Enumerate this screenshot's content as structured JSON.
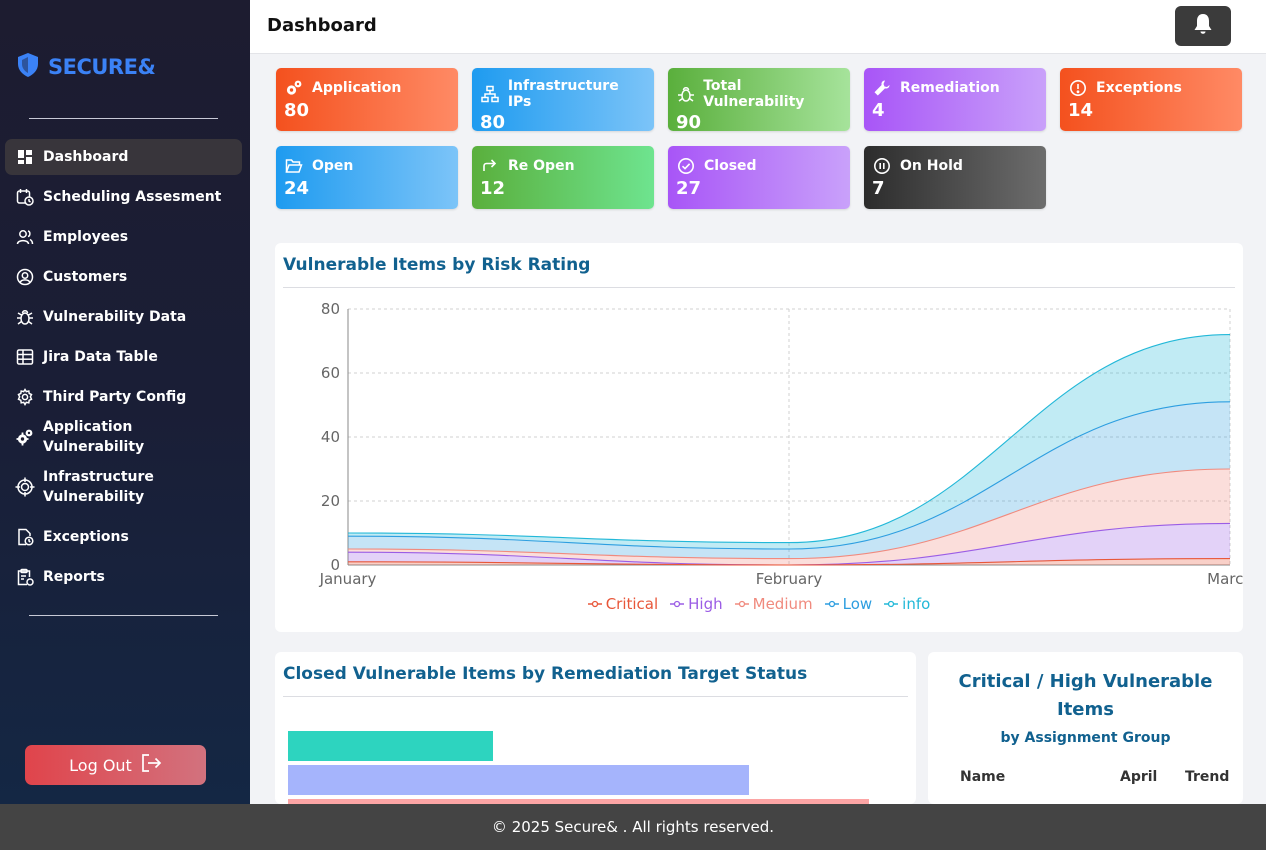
{
  "brand": {
    "name": "SECURE&"
  },
  "sidebar": {
    "items": [
      {
        "label": "Dashboard",
        "icon": "dashboard-icon",
        "active": true
      },
      {
        "label": "Scheduling Assesment",
        "icon": "calendar-clock-icon"
      },
      {
        "label": "Employees",
        "icon": "users-icon"
      },
      {
        "label": "Customers",
        "icon": "user-circle-icon"
      },
      {
        "label": "Vulnerability Data",
        "icon": "bug-icon"
      },
      {
        "label": "Jira Data Table",
        "icon": "table-icon"
      },
      {
        "label": "Third Party Config",
        "icon": "gear-icon"
      },
      {
        "label": "Application Vulnerability",
        "icon": "gears-icon"
      },
      {
        "label": "Infrastructure Vulnerability",
        "icon": "crosshair-icon"
      },
      {
        "label": "Exceptions",
        "icon": "file-clock-icon"
      },
      {
        "label": "Reports",
        "icon": "clipboard-icon"
      }
    ],
    "logout_label": "Log Out"
  },
  "header": {
    "title": "Dashboard"
  },
  "cards": [
    {
      "label": "Application",
      "value": "80",
      "icon": "gears-icon",
      "colors": [
        "#f4511e",
        "#ff8a65"
      ]
    },
    {
      "label": "Infrastructure IPs",
      "value": "80",
      "icon": "network-icon",
      "colors": [
        "#1e9bf0",
        "#7cc4f8"
      ]
    },
    {
      "label": "Total Vulnerability",
      "value": "90",
      "icon": "bug-icon",
      "colors": [
        "#5aaf3c",
        "#a6e39b"
      ]
    },
    {
      "label": "Remediation",
      "value": "4",
      "icon": "wrench-icon",
      "colors": [
        "#a855f7",
        "#c9a1fa"
      ]
    },
    {
      "label": "Exceptions",
      "value": "14",
      "icon": "alert-circle-icon",
      "colors": [
        "#f4511e",
        "#ff8a65"
      ]
    },
    {
      "label": "Open",
      "value": "24",
      "icon": "folder-open-icon",
      "colors": [
        "#1e9bf0",
        "#7cc4f8"
      ]
    },
    {
      "label": "Re Open",
      "value": "12",
      "icon": "reopen-arrow-icon",
      "colors": [
        "#5aaf3c",
        "#6ee48f"
      ]
    },
    {
      "label": "Closed",
      "value": "27",
      "icon": "check-circle-icon",
      "colors": [
        "#a855f7",
        "#c9a1fa"
      ]
    },
    {
      "label": "On Hold",
      "value": "7",
      "icon": "pause-circle-icon",
      "colors": [
        "#2c2c2c",
        "#6d6d6d"
      ]
    }
  ],
  "risk_panel": {
    "title": "Vulnerable Items by Risk Rating"
  },
  "chart_data": {
    "type": "area",
    "stacked": true,
    "categories": [
      "January",
      "February",
      "March"
    ],
    "ylim": [
      0,
      80
    ],
    "yticks": [
      0,
      20,
      40,
      60,
      80
    ],
    "grid": true,
    "legend_position": "bottom",
    "series": [
      {
        "name": "Critical",
        "values": [
          1,
          0,
          2
        ],
        "color": "#e8573a"
      },
      {
        "name": "High",
        "values": [
          3,
          0,
          11
        ],
        "color": "#9b5de5"
      },
      {
        "name": "Medium",
        "values": [
          1,
          2,
          17
        ],
        "color": "#f08a7e"
      },
      {
        "name": "Low",
        "values": [
          4,
          3,
          21
        ],
        "color": "#2d9ee0"
      },
      {
        "name": "info",
        "values": [
          1,
          2,
          21
        ],
        "color": "#22b8d8"
      }
    ]
  },
  "closed_panel": {
    "title": "Closed Vulnerable Items by Remediation Target Status"
  },
  "closed_bars": {
    "type": "bar",
    "values": [
      205,
      461,
      581
    ],
    "colors": [
      "#2dd4bf",
      "#a5b4fc",
      "#fca5a5"
    ]
  },
  "crit_panel": {
    "title": "Critical / High Vulnerable Items",
    "subtitle": "by Assignment Group",
    "columns": [
      "Name",
      "April",
      "Trend"
    ]
  },
  "footer": {
    "text": "© 2025 Secure& . All rights reserved."
  }
}
